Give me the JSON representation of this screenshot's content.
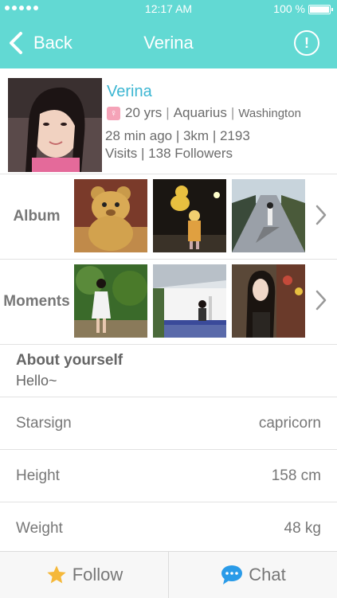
{
  "status_bar": {
    "time": "12:17 AM",
    "battery": "100 %"
  },
  "nav": {
    "back_label": "Back",
    "title": "Verina",
    "alert_icon": "alert-circle-icon"
  },
  "profile": {
    "name": "Verina",
    "age": "20 yrs",
    "zodiac": "Aquarius",
    "location": "Washington",
    "line2": "28 min ago | 3km | 2193",
    "line3": "Visits | 138 Followers"
  },
  "album": {
    "label": "Album"
  },
  "moments": {
    "label": "Moments"
  },
  "about": {
    "title": "About yourself",
    "text": "Hello~"
  },
  "details": [
    {
      "key": "Starsign",
      "value": "capricorn"
    },
    {
      "key": "Height",
      "value": "158 cm"
    },
    {
      "key": "Weight",
      "value": "48 kg"
    }
  ],
  "bottom": {
    "follow_label": "Follow",
    "chat_label": "Chat"
  },
  "colors": {
    "accent": "#62d9d3",
    "name": "#3cb6d2",
    "follow_star": "#f5b83a",
    "chat_bubble": "#2a9be8"
  }
}
